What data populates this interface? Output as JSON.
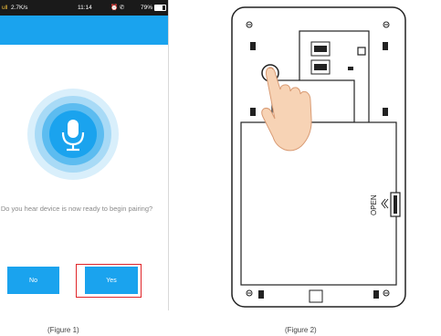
{
  "status_bar": {
    "signal_text": "ull",
    "speed": "2.7K/s",
    "time": "11:14",
    "icons_text": "⏰ ✆",
    "battery_text": "79%"
  },
  "prompt": {
    "text": "Do you hear device is now ready to begin pairing?"
  },
  "buttons": {
    "no_label": "No",
    "yes_label": "Yes"
  },
  "device": {
    "open_label": "OPEN"
  },
  "captions": {
    "figure1": "(Figure 1)",
    "figure2": "(Figure 2)"
  },
  "colors": {
    "accent_blue": "#1aa3ee",
    "highlight_red": "#e0262a"
  },
  "icons": [
    "microphone-icon",
    "signal-icon",
    "alarm-icon",
    "wifi-icon",
    "battery-icon",
    "screw-icon",
    "reset-button-icon",
    "hand-pointer-icon"
  ]
}
